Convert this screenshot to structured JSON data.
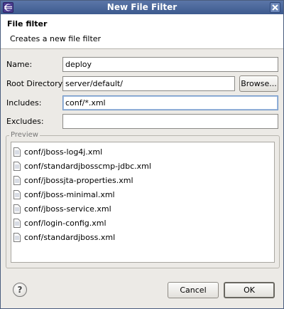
{
  "window": {
    "title": "New File Filter"
  },
  "header": {
    "title": "File filter",
    "description": "Creates a new file filter"
  },
  "form": {
    "name_label": "Name:",
    "name_value": "deploy",
    "root_label": "Root Directory:",
    "root_value": "server/default/",
    "browse_label": "Browse...",
    "includes_label": "Includes:",
    "includes_value": "conf/*.xml",
    "excludes_label": "Excludes:",
    "excludes_value": ""
  },
  "preview": {
    "label": "Preview",
    "files": [
      "conf/jboss-log4j.xml",
      "conf/standardjbosscmp-jdbc.xml",
      "conf/jbossjta-properties.xml",
      "conf/jboss-minimal.xml",
      "conf/jboss-service.xml",
      "conf/login-config.xml",
      "conf/standardjboss.xml"
    ]
  },
  "footer": {
    "help_label": "?",
    "cancel_label": "Cancel",
    "ok_label": "OK"
  },
  "icons": {
    "app": "eclipse-icon",
    "close": "close-icon",
    "file": "file-icon",
    "help": "help-icon"
  }
}
